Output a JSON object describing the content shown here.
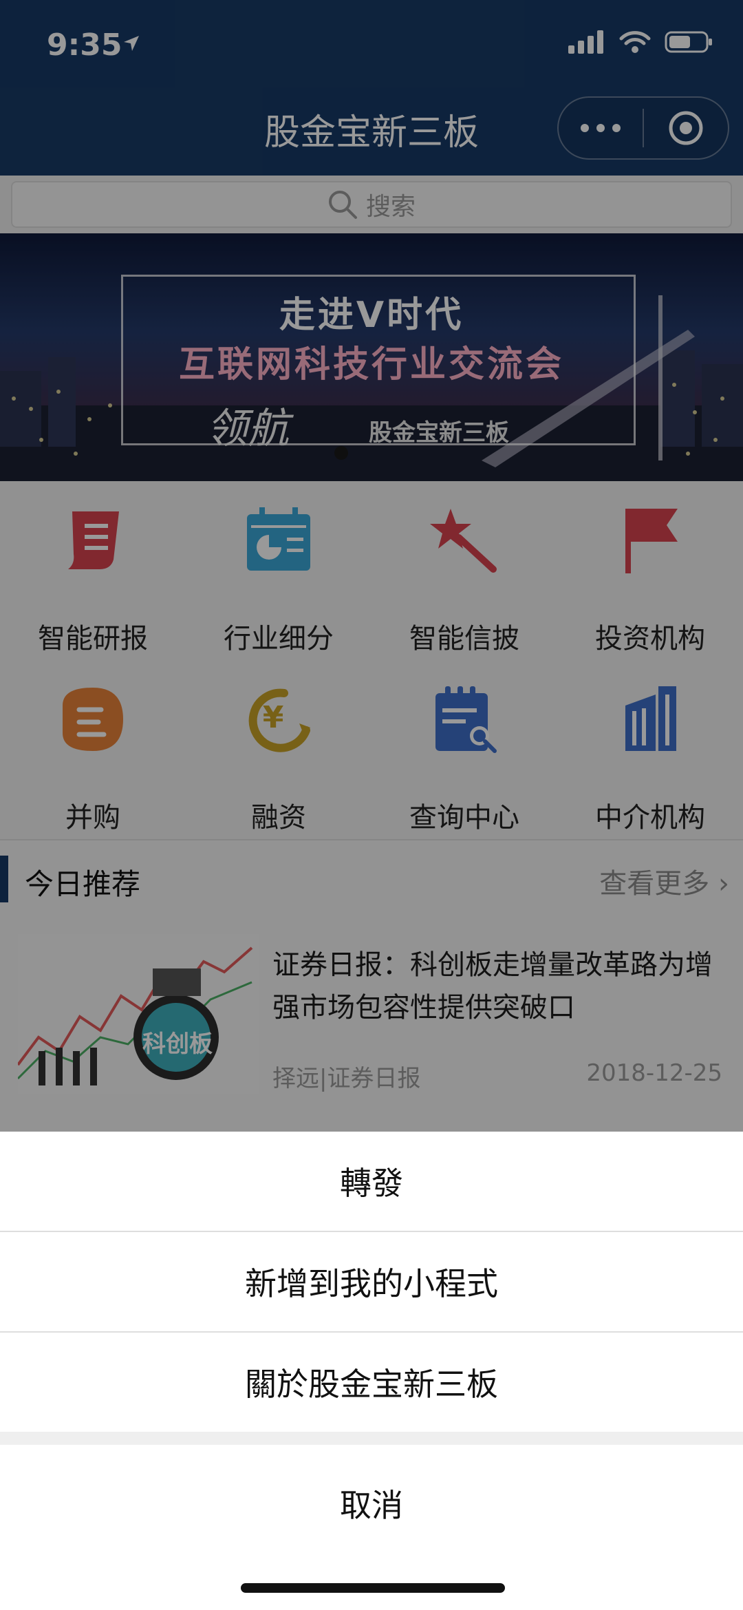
{
  "status_bar": {
    "time": "9:35"
  },
  "nav": {
    "title": "股金宝新三板"
  },
  "search": {
    "placeholder": "搜索"
  },
  "banner": {
    "line1": "走进V时代",
    "line2": "互联网科技行业交流会",
    "lead": "领航",
    "brand": "股金宝新三板"
  },
  "grid": [
    {
      "label": "智能研报",
      "icon": "report-icon",
      "color": "#d8434f"
    },
    {
      "label": "行业细分",
      "icon": "calendar-chart-icon",
      "color": "#3ba7d8"
    },
    {
      "label": "智能信披",
      "icon": "magic-wand-icon",
      "color": "#d8434f"
    },
    {
      "label": "投资机构",
      "icon": "flag-icon",
      "color": "#d8434f"
    },
    {
      "label": "并购",
      "icon": "handshake-icon",
      "color": "#e8823a"
    },
    {
      "label": "融资",
      "icon": "yen-growth-icon",
      "color": "#c9a227"
    },
    {
      "label": "查询中心",
      "icon": "search-document-icon",
      "color": "#3f6fc8"
    },
    {
      "label": "中介机构",
      "icon": "building-icon",
      "color": "#3f6fc8"
    }
  ],
  "recommend": {
    "title": "今日推荐",
    "more": "查看更多",
    "article": {
      "headline": "证券日报：科创板走增量改革路为增强市场包容性提供突破口",
      "source": "择远|证券日报",
      "date": "2018-12-25",
      "thumb_text": "科创板"
    }
  },
  "action_sheet": {
    "items": [
      "轉發",
      "新增到我的小程式",
      "關於股金宝新三板"
    ],
    "cancel": "取消"
  }
}
